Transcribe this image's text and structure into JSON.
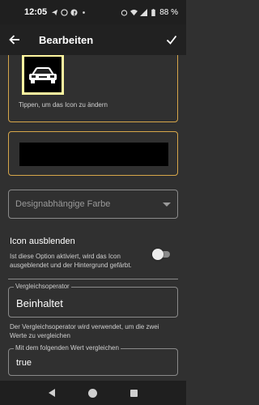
{
  "status_bar": {
    "time": "12:05",
    "battery": "88 %",
    "notification_icons": [
      "telegram-icon",
      "whatsapp-icon",
      "facebook-icon",
      "dot-icon"
    ],
    "system_icons": [
      "alarm-icon",
      "wifi-icon",
      "signal-icon",
      "battery-icon"
    ]
  },
  "app_bar": {
    "title": "Bearbeiten",
    "back_icon": "arrow-left-icon",
    "confirm_icon": "check-icon"
  },
  "icon_card": {
    "icon": "car-icon",
    "hint": "Tippen, um das Icon zu ändern"
  },
  "color_dropdown": {
    "value": "Designabhängige Farbe"
  },
  "hide_icon": {
    "title": "Icon ausblenden",
    "description": "Ist diese Option aktiviert, wird das Icon ausgeblendet und der Hintergrund gefärbt.",
    "enabled": false
  },
  "comparison_operator": {
    "label": "Vergleichsoperator",
    "value": "Beinhaltet",
    "help": "Der Vergleichsoperator wird verwendet, um die zwei Werte zu vergleichen"
  },
  "compare_value": {
    "label": "Mit dem folgenden Wert vergleichen",
    "value": "true"
  },
  "nav_bar": {
    "icons": [
      "nav-back-icon",
      "nav-home-icon",
      "nav-recents-icon"
    ]
  },
  "colors": {
    "accent_border": "#d6a64a",
    "background": "#303030",
    "icon_frame": "#fff6a0"
  }
}
